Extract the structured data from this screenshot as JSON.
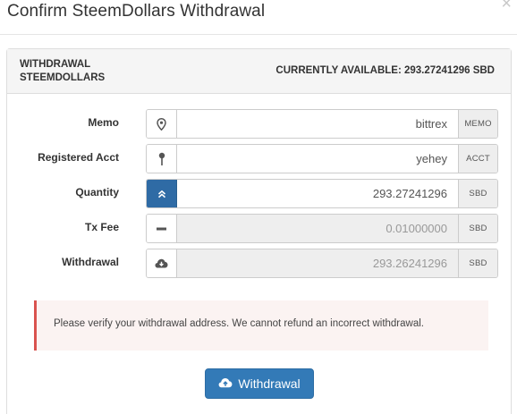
{
  "modal": {
    "title": "Confirm SteemDollars Withdrawal",
    "close_label": "×"
  },
  "panel": {
    "heading_line1": "WITHDRAWAL",
    "heading_line2": "STEEMDOLLARS",
    "available_text": "CURRENTLY AVAILABLE: 293.27241296 SBD"
  },
  "fields": [
    {
      "label": "Memo",
      "icon": "map-marker-icon",
      "value": "bittrex",
      "unit": "MEMO",
      "disabled": false
    },
    {
      "label": "Registered Acct",
      "icon": "pushpin-icon",
      "value": "yehey",
      "unit": "ACCT",
      "disabled": false
    },
    {
      "label": "Quantity",
      "icon": "double-chevron-up-icon",
      "value": "293.27241296",
      "unit": "SBD",
      "disabled": false
    },
    {
      "label": "Tx Fee",
      "icon": "minus-icon",
      "value": "0.01000000",
      "unit": "SBD",
      "disabled": true
    },
    {
      "label": "Withdrawal",
      "icon": "cloud-download-icon",
      "value": "293.26241296",
      "unit": "SBD",
      "disabled": true
    }
  ],
  "alert": {
    "message": "Please verify your withdrawal address. We cannot refund an incorrect withdrawal."
  },
  "actions": {
    "withdraw_label": "Withdrawal",
    "withdraw_icon": "cloud-upload-icon"
  },
  "colors": {
    "primary": "#337ab7",
    "alert_border": "#d9534f",
    "alert_bg": "#fbf3f2"
  }
}
